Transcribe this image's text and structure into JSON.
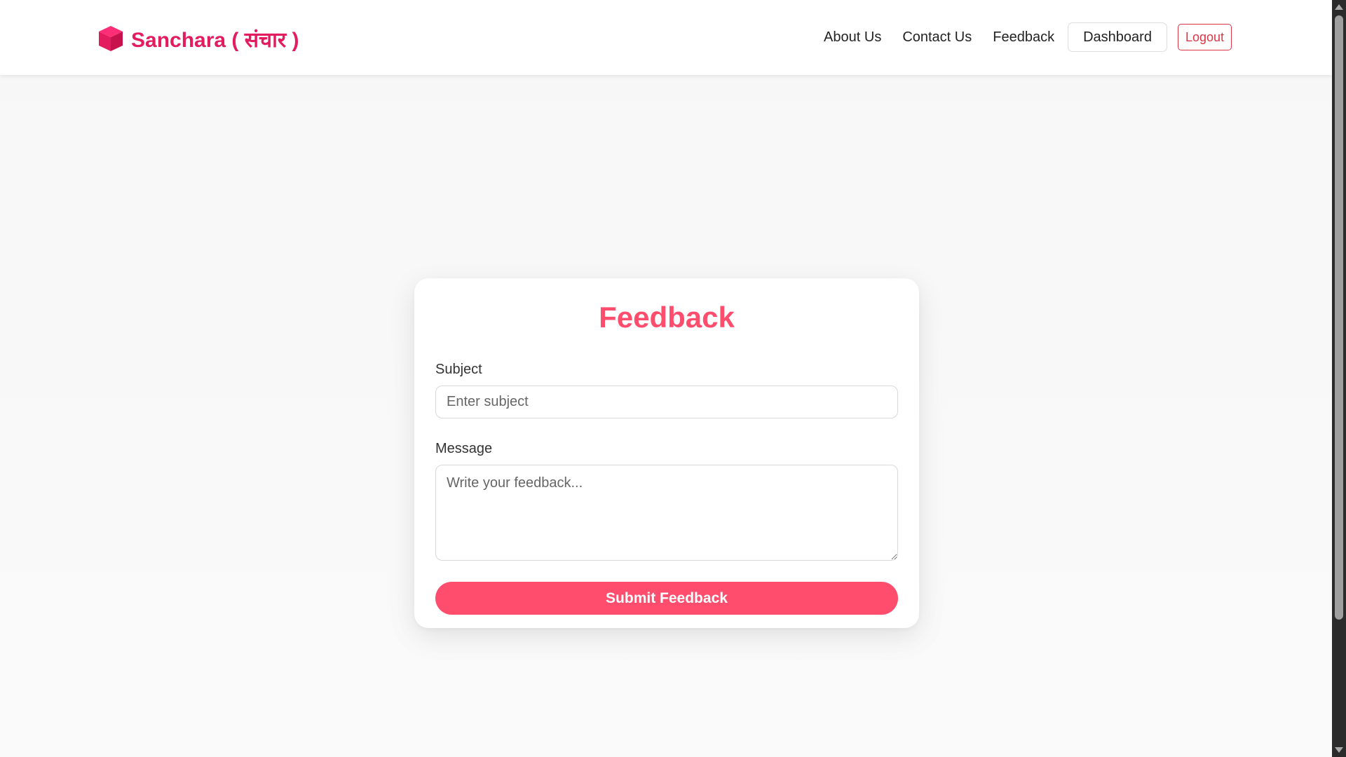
{
  "navbar": {
    "brand": "Sanchara ( संचार )",
    "brand_icon": "cube-icon",
    "brand_color": "#e31c5f",
    "links": {
      "about": "About Us",
      "contact": "Contact Us",
      "feedback": "Feedback"
    },
    "dashboard_label": "Dashboard",
    "logout_label": "Logout",
    "logout_color": "#dc3545"
  },
  "form": {
    "title": "Feedback",
    "accent_color": "#ff4d6d",
    "subject_label": "Subject",
    "subject_placeholder": "Enter subject",
    "subject_value": "",
    "message_label": "Message",
    "message_placeholder": "Write your feedback...",
    "message_value": "",
    "submit_label": "Submit Feedback"
  }
}
